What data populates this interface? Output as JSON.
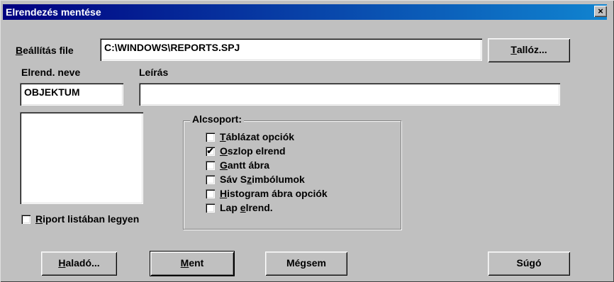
{
  "window": {
    "title": "Elrendezés mentése",
    "close": "×"
  },
  "settings_file": {
    "label_prefix": "B",
    "label_rest": "eállítás file",
    "value": "C:\\WINDOWS\\REPORTS.SPJ"
  },
  "browse_button": {
    "prefix": "T",
    "rest": "allóz..."
  },
  "layout_name": {
    "label": "Elrend. neve",
    "value": "OBJEKTUM"
  },
  "description": {
    "label": "Leírás",
    "value": ""
  },
  "report_list_checkbox": {
    "label_prefix": "R",
    "label_rest": "iport listában legyen",
    "checked": false
  },
  "subgroup": {
    "title": "Alcsoport:",
    "items": [
      {
        "pre": "",
        "key": "T",
        "post": "áblázat opciók",
        "checked": false
      },
      {
        "pre": "",
        "key": "O",
        "post": "szlop elrend",
        "checked": true
      },
      {
        "pre": "",
        "key": "G",
        "post": "antt ábra",
        "checked": false
      },
      {
        "pre": "Sáv S",
        "key": "z",
        "post": "imbólumok",
        "checked": false
      },
      {
        "pre": "",
        "key": "H",
        "post": "istogram ábra opciók",
        "checked": false
      },
      {
        "pre": "Lap ",
        "key": "e",
        "post": "lrend.",
        "checked": false
      }
    ]
  },
  "buttons": {
    "advanced": {
      "prefix": "H",
      "rest": "aladó..."
    },
    "save": {
      "prefix": "M",
      "rest": "ent"
    },
    "cancel": {
      "label": "Mégsem"
    },
    "help": {
      "label": "Súgó"
    }
  },
  "check_mark": "✔"
}
